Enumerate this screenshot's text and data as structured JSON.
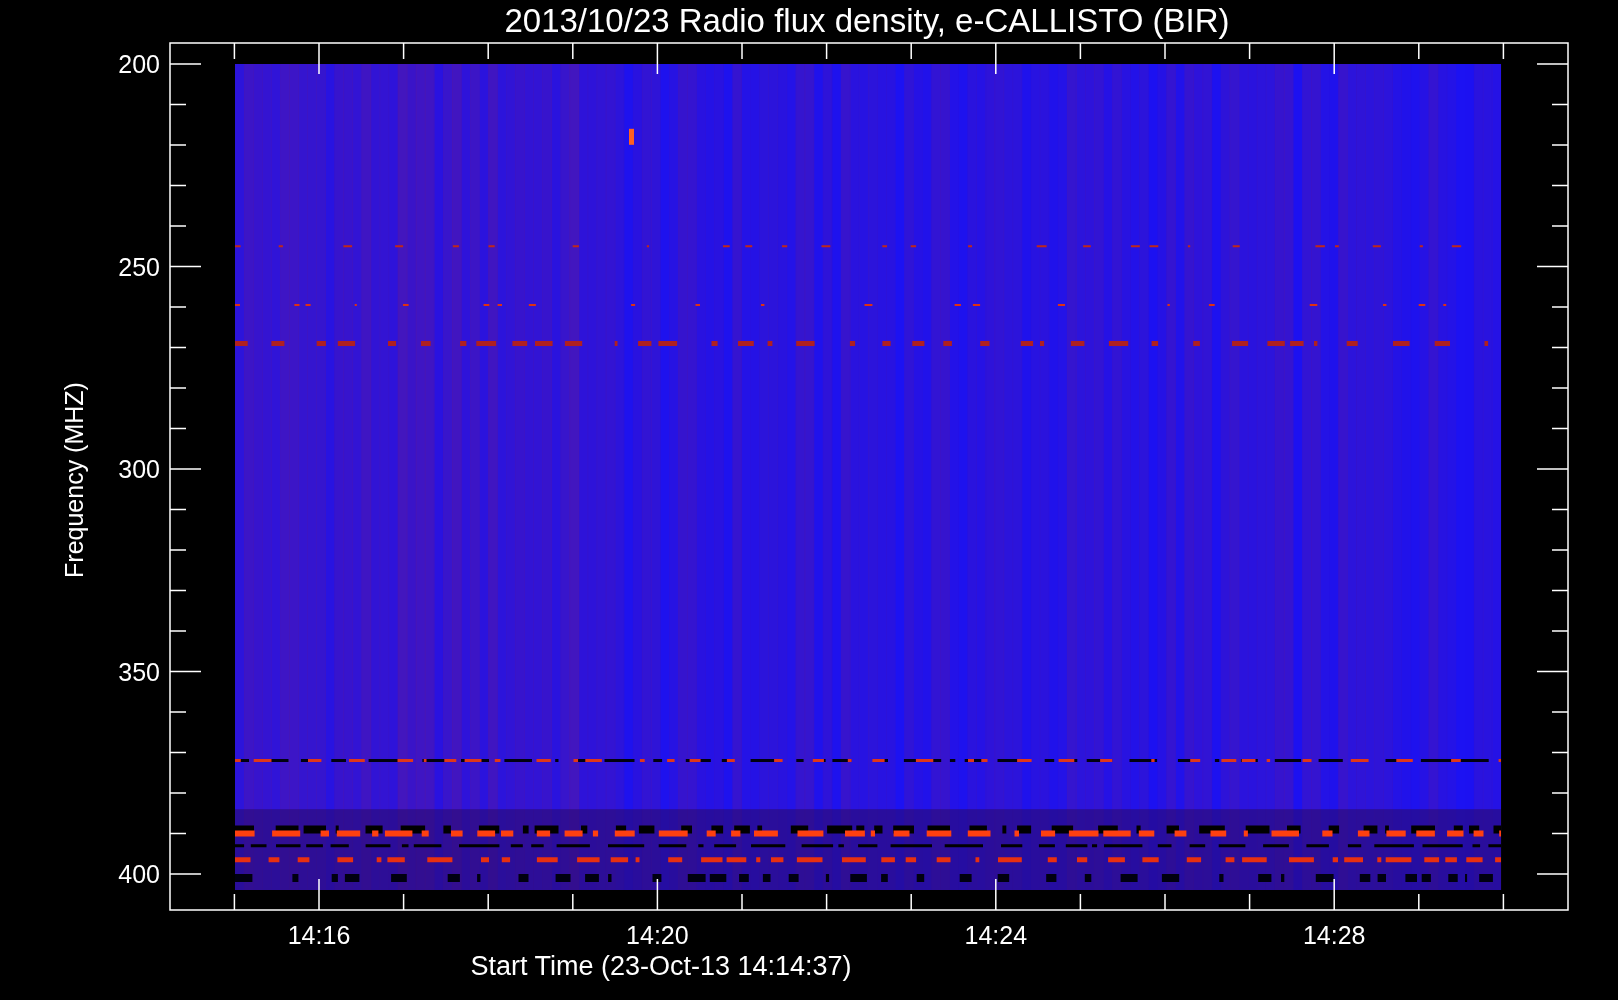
{
  "title": "2013/10/23  Radio flux density, e-CALLISTO (BIR)",
  "y_axis": {
    "title": "Frequency (MHZ)",
    "ticks": [
      "200",
      "250",
      "300",
      "350",
      "400"
    ]
  },
  "x_axis": {
    "title": "Start Time (23-Oct-13 14:14:37)",
    "ticks": [
      "14:16",
      "14:20",
      "14:24",
      "14:28"
    ]
  }
}
